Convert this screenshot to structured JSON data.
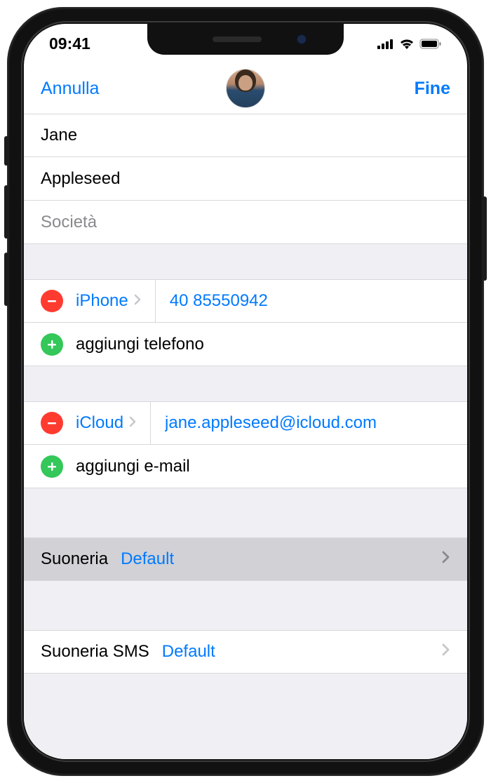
{
  "status": {
    "time": "09:41"
  },
  "nav": {
    "cancel": "Annulla",
    "done": "Fine"
  },
  "name": {
    "first": "Jane",
    "last": "Appleseed",
    "company_placeholder": "Società"
  },
  "phone": {
    "type_label": "iPhone",
    "number": "40 85550942",
    "add_label": "aggiungi telefono"
  },
  "email": {
    "type_label": "iCloud",
    "address": "jane.appleseed@icloud.com",
    "add_label": "aggiungi e-mail"
  },
  "ringtone": {
    "label": "Suoneria",
    "value": "Default"
  },
  "text_tone": {
    "label": "Suoneria SMS",
    "value": "Default"
  }
}
